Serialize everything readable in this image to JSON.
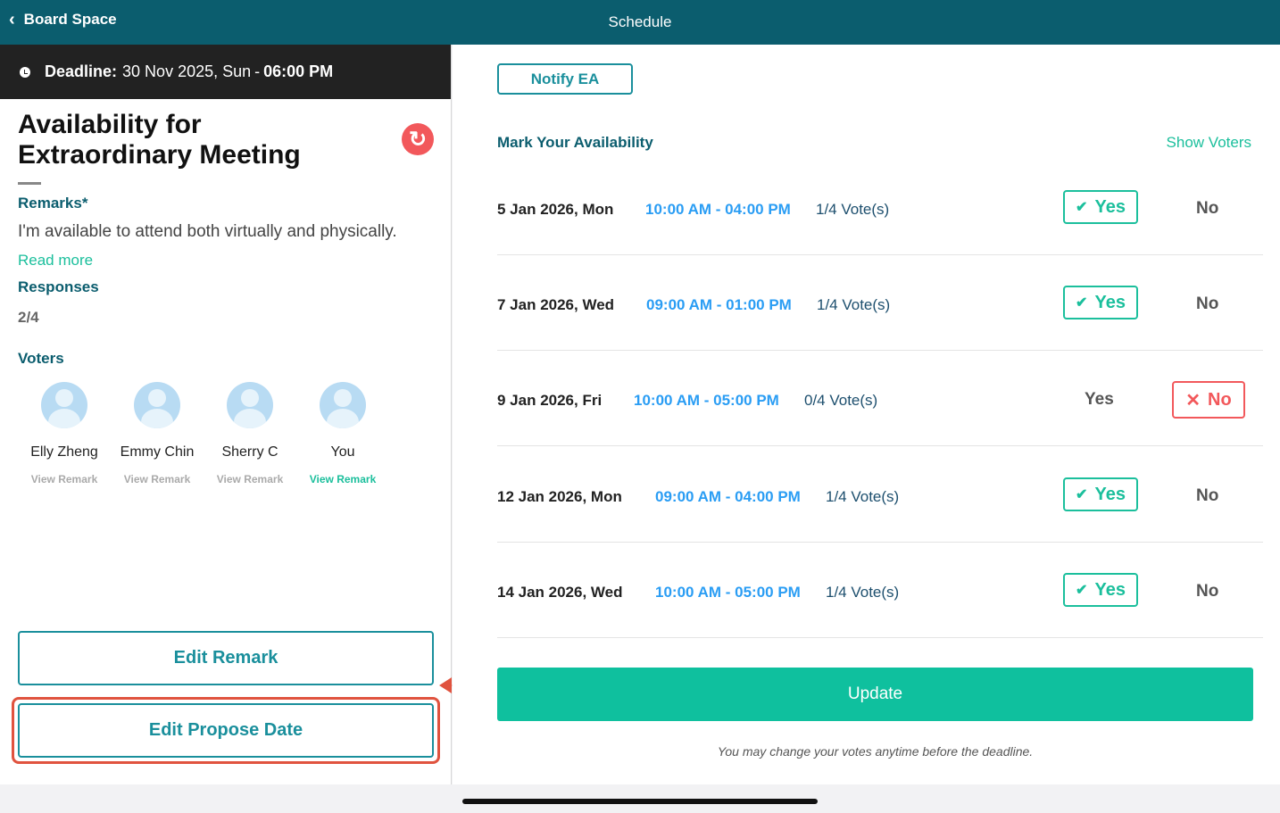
{
  "header": {
    "back_label": "Board Space",
    "title": "Schedule"
  },
  "deadline": {
    "label": "Deadline:",
    "date": "30 Nov 2025, Sun",
    "separator": "-",
    "time": "06:00 PM"
  },
  "meeting": {
    "title": "Availability for Extraordinary Meeting",
    "remarks_label": "Remarks*",
    "remarks_text": "I'm available to attend both virtually and physically.",
    "read_more": "Read more",
    "responses_label": "Responses",
    "responses_value": "2/4",
    "voters_label": "Voters"
  },
  "voters": [
    {
      "name": "Elly Zheng",
      "action": "View Remark"
    },
    {
      "name": "Emmy Chin",
      "action": "View Remark"
    },
    {
      "name": "Sherry C",
      "action": "View Remark"
    },
    {
      "name": "You",
      "action": "View Remark"
    }
  ],
  "buttons": {
    "edit_remark": "Edit Remark",
    "edit_propose_date": "Edit Propose Date",
    "notify": "Notify EA",
    "update": "Update"
  },
  "availability": {
    "title": "Mark Your Availability",
    "show_voters": "Show Voters",
    "yes_label": "Yes",
    "no_label": "No",
    "rows": [
      {
        "date": "5 Jan 2026, Mon",
        "time": "10:00 AM - 04:00 PM",
        "votes": "1/4 Vote(s)",
        "selected": "yes"
      },
      {
        "date": "7 Jan 2026, Wed",
        "time": "09:00 AM - 01:00 PM",
        "votes": "1/4 Vote(s)",
        "selected": "yes"
      },
      {
        "date": "9 Jan 2026, Fri",
        "time": "10:00 AM - 05:00 PM",
        "votes": "0/4 Vote(s)",
        "selected": "no"
      },
      {
        "date": "12 Jan 2026, Mon",
        "time": "09:00 AM - 04:00 PM",
        "votes": "1/4 Vote(s)",
        "selected": "yes"
      },
      {
        "date": "14 Jan 2026, Wed",
        "time": "10:00 AM - 05:00 PM",
        "votes": "1/4 Vote(s)",
        "selected": "yes"
      }
    ]
  },
  "footnote": "You may change your votes anytime before the deadline.",
  "colors": {
    "header": "#0b5d6e",
    "accent": "#1bbf9c",
    "danger": "#f2585b",
    "time": "#2a9df4",
    "highlight": "#e0533f"
  }
}
